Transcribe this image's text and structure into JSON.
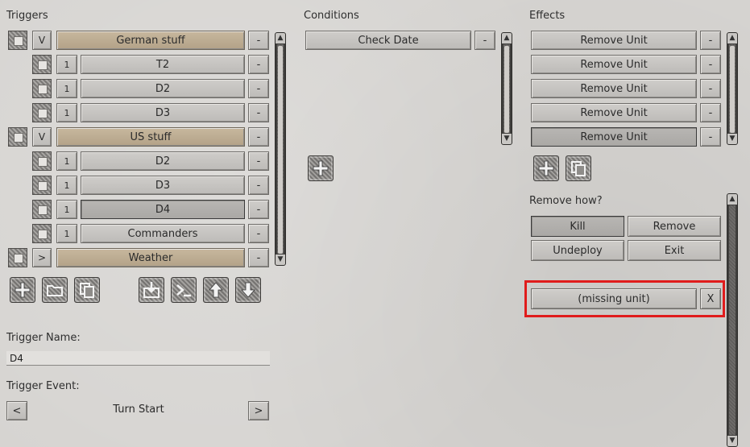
{
  "headers": {
    "triggers": "Triggers",
    "conditions": "Conditions",
    "effects": "Effects"
  },
  "triggers": [
    {
      "type": "group",
      "toggle": "V",
      "label": "German stuff",
      "minus": "-"
    },
    {
      "type": "item",
      "count": "1",
      "label": "T2",
      "minus": "-"
    },
    {
      "type": "item",
      "count": "1",
      "label": "D2",
      "minus": "-"
    },
    {
      "type": "item",
      "count": "1",
      "label": "D3",
      "minus": "-"
    },
    {
      "type": "group",
      "toggle": "V",
      "label": "US stuff",
      "minus": "-"
    },
    {
      "type": "item",
      "count": "1",
      "label": "D2",
      "minus": "-"
    },
    {
      "type": "item",
      "count": "1",
      "label": "D3",
      "minus": "-"
    },
    {
      "type": "item",
      "count": "1",
      "label": "D4",
      "minus": "-",
      "selected": true
    },
    {
      "type": "item",
      "count": "1",
      "label": "Commanders",
      "minus": "-"
    },
    {
      "type": "group",
      "toggle": ">",
      "label": "Weather",
      "minus": "-"
    }
  ],
  "trigger_tools": [
    "add-icon",
    "folder-icon",
    "copy-icon",
    "import-icon",
    "console-icon",
    "move-up-icon",
    "move-down-icon"
  ],
  "conditions": [
    {
      "label": "Check Date",
      "minus": "-"
    }
  ],
  "condition_tools": [
    "add-icon"
  ],
  "effects": [
    {
      "label": "Remove Unit",
      "minus": "-"
    },
    {
      "label": "Remove Unit",
      "minus": "-"
    },
    {
      "label": "Remove Unit",
      "minus": "-"
    },
    {
      "label": "Remove Unit",
      "minus": "-"
    },
    {
      "label": "Remove Unit",
      "minus": "-",
      "selected": true
    }
  ],
  "effect_tools": [
    "add-icon",
    "copy-icon"
  ],
  "remove_how": {
    "label": "Remove how?",
    "options": [
      "Kill",
      "Remove",
      "Undeploy",
      "Exit"
    ],
    "selected": "Kill"
  },
  "unit": {
    "label": "(missing unit)",
    "clear": "X"
  },
  "trigger_name": {
    "label": "Trigger Name:",
    "value": "D4"
  },
  "trigger_event": {
    "label": "Trigger Event:",
    "prev": "<",
    "value": "Turn Start",
    "next": ">"
  },
  "colors": {
    "highlight_box": "#e01c1c",
    "group_row": "#bfae94"
  }
}
